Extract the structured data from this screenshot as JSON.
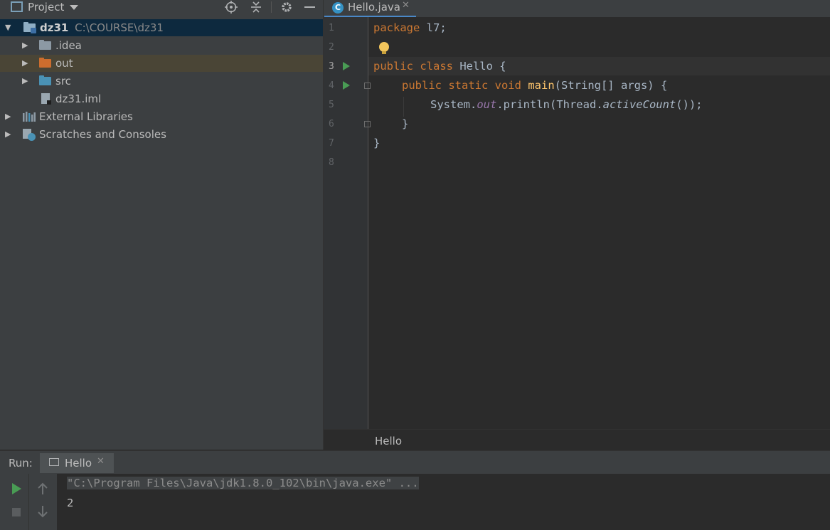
{
  "project_panel": {
    "title": "Project",
    "header_icons": [
      "locate-icon",
      "collapse-icon",
      "gear-icon",
      "minimize-icon"
    ],
    "tree": [
      {
        "label": "dz31",
        "hint": "C:\\COURSE\\dz31",
        "type": "module"
      },
      {
        "label": ".idea",
        "type": "folder"
      },
      {
        "label": "out",
        "type": "folder-excluded"
      },
      {
        "label": "src",
        "type": "folder-source"
      },
      {
        "label": "dz31.iml",
        "type": "file"
      },
      {
        "label": "External Libraries",
        "type": "libraries"
      },
      {
        "label": "Scratches and Consoles",
        "type": "scratches"
      }
    ]
  },
  "editor": {
    "tab_label": "Hello.java",
    "line_numbers": [
      "1",
      "2",
      "3",
      "4",
      "5",
      "6",
      "7",
      "8"
    ],
    "code": {
      "l1_kw": "package",
      "l1_rest": " l7;",
      "l3_kw": "public class",
      "l3_rest": " Hello {",
      "l4_kw": "public static void",
      "l4_fn": "main",
      "l4_rest": "(String[] args) {",
      "l5_a": "System.",
      "l5_field": "out",
      "l5_b": ".println(Thread.",
      "l5_static": "activeCount",
      "l5_c": "());",
      "l6": "}",
      "l7": "}"
    },
    "breadcrumb": "Hello"
  },
  "run_panel": {
    "label": "Run:",
    "tab_label": "Hello",
    "console_cmd": "\"C:\\Program Files\\Java\\jdk1.8.0_102\\bin\\java.exe\" ...",
    "console_output": "2"
  },
  "colors": {
    "keyword": "#cc7832",
    "function": "#ffc66d",
    "field": "#9876aa",
    "run_green": "#499c54",
    "selection": "#0d293e"
  }
}
